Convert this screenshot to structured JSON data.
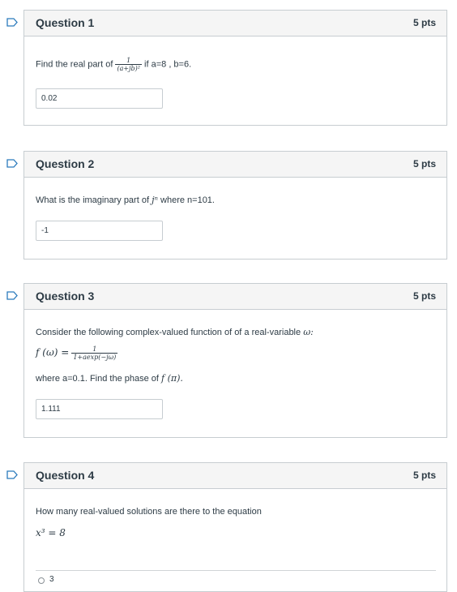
{
  "questions": [
    {
      "title": "Question 1",
      "points": "5 pts",
      "prompt_before": "Find the real part of",
      "fraction": {
        "num": "1",
        "den": "(a+jb)²"
      },
      "prompt_after": "if a=8 , b=6.",
      "answer": "0.02"
    },
    {
      "title": "Question 2",
      "points": "5 pts",
      "prompt_before": "What is the imaginary part of",
      "math": "jⁿ",
      "prompt_after": "where n=101.",
      "answer": "-1"
    },
    {
      "title": "Question 3",
      "points": "5 pts",
      "prompt": "Consider the following complex-valued function of of a real-variable",
      "prompt_var": "ω:",
      "formula_lhs": "f (ω) =",
      "fraction": {
        "num": "1",
        "den": "1+aexp(−jω)"
      },
      "prompt2_before": "where a=0.1. Find the phase of",
      "prompt2_math": "f (π).",
      "answer": "1.111"
    },
    {
      "title": "Question 4",
      "points": "5 pts",
      "prompt": "How many real-valued solutions are there to the equation",
      "equation": "x³ = 8",
      "option_first": "3"
    }
  ],
  "colors": {
    "accent": "#2a7abc",
    "border": "#c7cdd1",
    "header_bg": "#f5f5f5",
    "text": "#2d3b45"
  }
}
